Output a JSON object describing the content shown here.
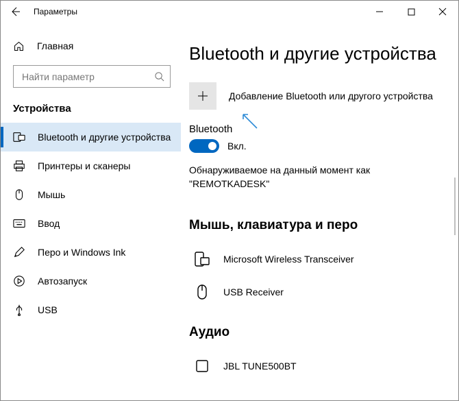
{
  "titlebar": {
    "title": "Параметры"
  },
  "sidebar": {
    "home": "Главная",
    "search_placeholder": "Найти параметр",
    "section": "Устройства",
    "items": [
      {
        "label": "Bluetooth и другие устройства"
      },
      {
        "label": "Принтеры и сканеры"
      },
      {
        "label": "Мышь"
      },
      {
        "label": "Ввод"
      },
      {
        "label": "Перо и Windows Ink"
      },
      {
        "label": "Автозапуск"
      },
      {
        "label": "USB"
      }
    ]
  },
  "main": {
    "title": "Bluetooth и другие устройства",
    "add_label": "Добавление Bluetooth или другого устройства",
    "bt_label": "Bluetooth",
    "toggle_state": "Вкл.",
    "discover_line1": "Обнаруживаемое на данный момент как",
    "discover_line2": "\"REMOTKADESK\"",
    "section_mouse": "Мышь, клавиатура и перо",
    "devices": [
      {
        "label": "Microsoft Wireless Transceiver"
      },
      {
        "label": "USB Receiver"
      }
    ],
    "section_audio": "Аудио",
    "audio_devices": [
      {
        "label": "JBL TUNE500BT"
      }
    ]
  }
}
